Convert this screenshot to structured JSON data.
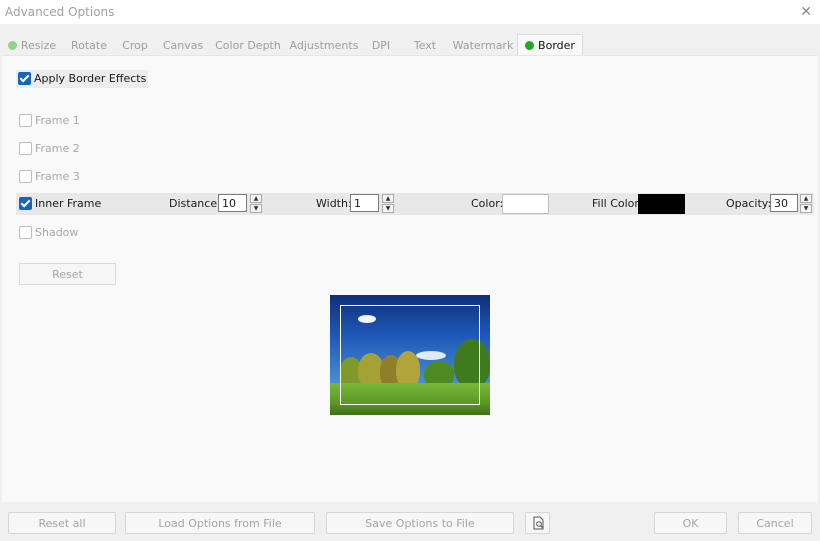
{
  "window": {
    "title": "Advanced Options",
    "close_glyph": "✕"
  },
  "tabs": [
    {
      "label": "Resize",
      "dot": "light-green"
    },
    {
      "label": "Rotate"
    },
    {
      "label": "Crop"
    },
    {
      "label": "Canvas"
    },
    {
      "label": "Color Depth"
    },
    {
      "label": "Adjustments"
    },
    {
      "label": "DPI"
    },
    {
      "label": "Text"
    },
    {
      "label": "Watermark"
    },
    {
      "label": "Border",
      "dot": "green",
      "active": true
    }
  ],
  "border": {
    "apply_label": "Apply Border Effects",
    "apply_checked": true,
    "frame1_label": "Frame 1",
    "frame2_label": "Frame 2",
    "frame3_label": "Frame 3",
    "inner_frame": {
      "label": "Inner Frame",
      "checked": true,
      "distance_label": "Distance:",
      "distance_value": "10",
      "width_label": "Width:",
      "width_value": "1",
      "color_label": "Color:",
      "color_value": "#ffffff",
      "fill_color_label": "Fill Color:",
      "fill_color_value": "#000000",
      "opacity_label": "Opacity:",
      "opacity_value": "30"
    },
    "shadow_label": "Shadow",
    "reset_label": "Reset"
  },
  "footer": {
    "reset_all": "Reset all",
    "load": "Load Options from File",
    "save": "Save Options to File",
    "ok": "OK",
    "cancel": "Cancel"
  },
  "colors": {
    "accent": "#1464c0",
    "tab_dot_green": "#1faa1f",
    "tab_dot_light_green": "#8fd48f"
  }
}
